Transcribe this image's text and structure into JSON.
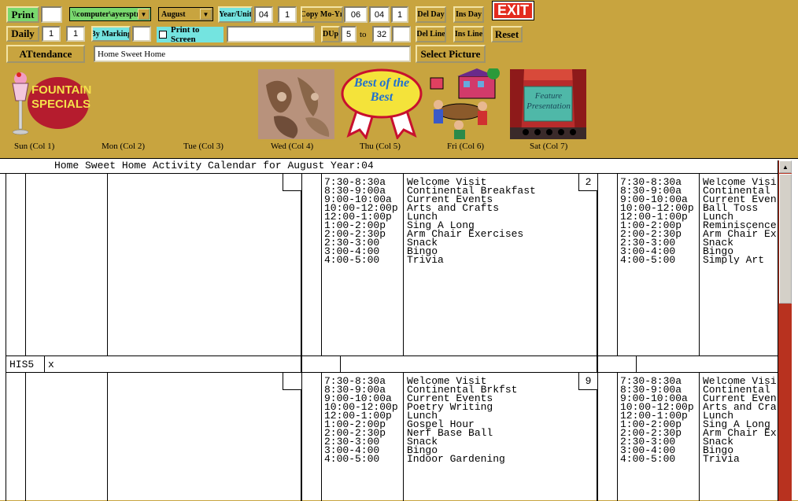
{
  "toolbar": {
    "print_label": "Print",
    "daily_label": "Daily",
    "attendance_label": "ATtendance",
    "path_value": "\\\\computer\\ayersptr",
    "month_value": "August",
    "year_unit_label": "Year/Unit",
    "year_value": "04",
    "unit_value": "1",
    "copy_label": "Copy Mo-Yr",
    "copy_month": "06",
    "copy_year": "04",
    "copy_unit": "1",
    "del_day_label": "Del Day",
    "ins_day_label": "Ins Day",
    "del_line_label": "Del Line",
    "ins_line_label": "Ins Line",
    "exit_label": "EXIT",
    "reset_label": "Reset",
    "daily_from": "1",
    "daily_to": "1",
    "by_marking_label": "By Marking",
    "by_marking_value": "",
    "print_to_screen_label": "Print to Screen",
    "print_to_screen_checked": false,
    "print_screen_field": "",
    "dup_label": "DUp",
    "dup_from": "5",
    "dup_to_label": "to",
    "dup_to": "32",
    "dup_extra": "",
    "facility_name": "Home Sweet Home",
    "select_picture_label": "Select Picture",
    "print_copies": ""
  },
  "pictures": [
    {
      "name": "fountain-specials",
      "text": "FOUNTAIN SPECIALS"
    },
    {
      "name": "fabric",
      "text": ""
    },
    {
      "name": "best-of-the-best",
      "text": "Best of the Best"
    },
    {
      "name": "picnic",
      "text": ""
    },
    {
      "name": "feature-presentation",
      "text": "Feature Presentation"
    }
  ],
  "day_labels": [
    "Sun (Col 1)",
    "Mon (Col 2)",
    "Tue (Col 3)",
    "Wed (Col 4)",
    "Thu (Col 5)",
    "Fri (Col 6)",
    "Sat (Col 7)"
  ],
  "calendar": {
    "header": "Home Sweet Home Activity Calendar for August Year:04",
    "row_label": "HIS5",
    "row_value": "x",
    "week1": {
      "day_a_number": "2",
      "day_a_times": "7:30-8:30a\n8:30-9:00a\n9:00-10:00a\n10:00-12:00p\n12:00-1:00p\n1:00-2:00p\n2:00-2:30p\n2:30-3:00\n3:00-4:00\n4:00-5:00",
      "day_a_acts": "Welcome Visit\nContinental Breakfast\nCurrent Events\nArts and Crafts\nLunch\nSing A Long\nArm Chair Exercises\nSnack\nBingo\nTrivia",
      "day_b_times": "7:30-8:30a\n8:30-9:00a\n9:00-10:00a\n10:00-12:00p\n12:00-1:00p\n1:00-2:00p\n2:00-2:30p\n2:30-3:00\n3:00-4:00\n4:00-5:00",
      "day_b_acts": "Welcome Visi\nContinental\nCurrent Even\nBall Toss\nLunch\nReminiscence\nArm Chair Ex\nSnack\nBingo\nSimply Art"
    },
    "week2": {
      "day_a_number": "9",
      "day_a_times": "7:30-8:30a\n8:30-9:00a\n9:00-10:00a\n10:00-12:00p\n12:00-1:00p\n1:00-2:00p\n2:00-2:30p\n2:30-3:00\n3:00-4:00\n4:00-5:00",
      "day_a_acts": "Welcome Visit\nContinental Brkfst\nCurrent Events\nPoetry Writing\nLunch\nGospel Hour\nNerf Base Ball\nSnack\nBingo\nIndoor Gardening",
      "day_b_times": "7:30-8:30a\n8:30-9:00a\n9:00-10:00a\n10:00-12:00p\n12:00-1:00p\n1:00-2:00p\n2:00-2:30p\n2:30-3:00\n3:00-4:00\n4:00-5:00",
      "day_b_acts": "Welcome Visi\nContinental\nCurrent Even\nArts and Cra\nLunch\nSing A Long\nArm Chair Ex\nSnack\nBingo\nTrivia"
    }
  },
  "colors": {
    "background": "#c8a43f",
    "green_button": "#79d86e",
    "cyan_button": "#74e4e0",
    "exit_red": "#e32b1e",
    "scrollbar_track": "#b8321f"
  }
}
